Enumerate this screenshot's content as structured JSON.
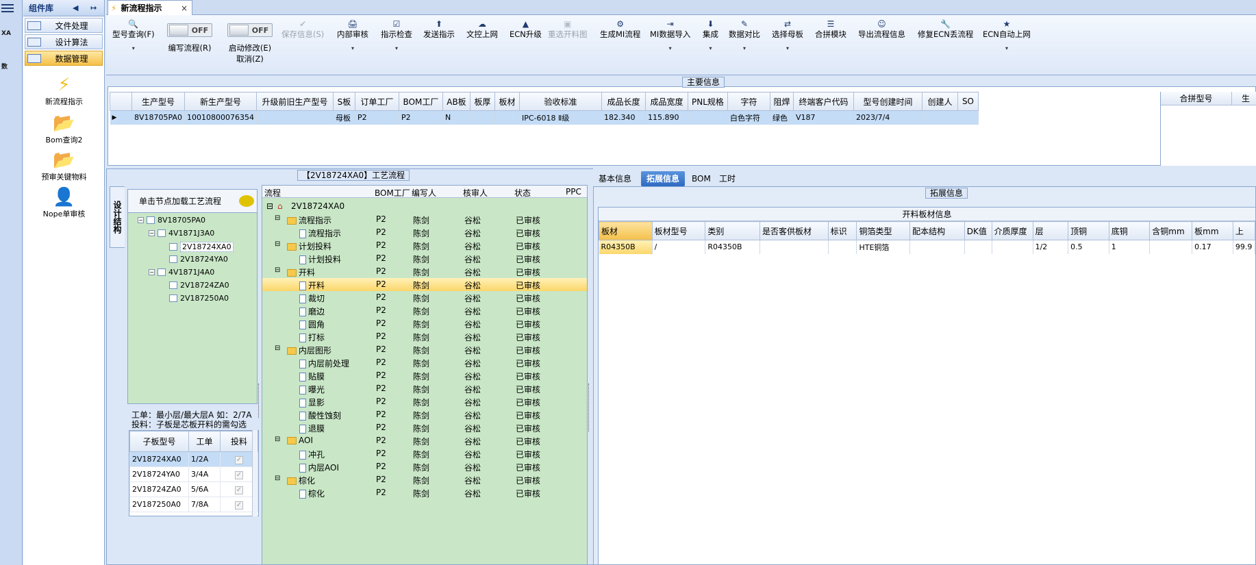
{
  "left_strip": {
    "app_icons": [
      "XA",
      "数"
    ]
  },
  "complib": {
    "title": "组件库",
    "nav": [
      "文件处理",
      "设计算法",
      "数据管理"
    ],
    "tools": [
      "新流程指示",
      "Bom查询2",
      "预审关键物料",
      "Nope单审核"
    ]
  },
  "tab": {
    "title": "新流程指示",
    "close": "×"
  },
  "ribbon": {
    "buttons": [
      {
        "label": "型号查询(F)",
        "icon": "🔍",
        "dd": "▾"
      },
      {
        "label": "保存信息(S)",
        "icon": "✔",
        "dd": ""
      },
      {
        "label": "内部审核",
        "icon": "🖨",
        "dd": "▾"
      },
      {
        "label": "指示检查",
        "icon": "☑",
        "dd": "▾"
      },
      {
        "label": "发送指示",
        "icon": "⬆",
        "dd": ""
      },
      {
        "label": "文控上网",
        "icon": "☁",
        "dd": ""
      },
      {
        "label": "ECN升级",
        "icon": "▲",
        "dd": ""
      },
      {
        "label": "重选开料图",
        "icon": "▣",
        "dd": ""
      },
      {
        "label": "生成MI流程",
        "icon": "⚙",
        "dd": ""
      },
      {
        "label": "MI数据导入",
        "icon": "⇥",
        "dd": "▾"
      },
      {
        "label": "集成",
        "icon": "⬇",
        "dd": "▾"
      },
      {
        "label": "数据对比",
        "icon": "✎",
        "dd": "▾"
      },
      {
        "label": "选择母板",
        "icon": "⇄",
        "dd": "▾"
      },
      {
        "label": "合拼模块",
        "icon": "☰",
        "dd": ""
      },
      {
        "label": "导出流程信息",
        "icon": "☺",
        "dd": ""
      },
      {
        "label": "修复ECN丢流程",
        "icon": "🔧",
        "dd": ""
      },
      {
        "label": "ECN自动上网",
        "icon": "★",
        "dd": "▾"
      }
    ],
    "toggle1": {
      "value": "OFF",
      "label": "编写流程(R)"
    },
    "toggle2": {
      "value": "OFF",
      "label1": "启动修改(E)",
      "label2": "取消(Z)"
    }
  },
  "main_info": {
    "title": "主要信息",
    "columns": [
      "生产型号",
      "新生产型号",
      "升级前旧生产型号",
      "S板",
      "订单工厂",
      "BOM工厂",
      "AB板",
      "板厚",
      "板材",
      "验收标准",
      "成品长度",
      "成品宽度",
      "PNL规格",
      "字符",
      "阻焊",
      "终端客户代码",
      "型号创建时间",
      "创建人",
      "SO"
    ],
    "row": [
      "8V18705PA0",
      "10010800076354",
      "",
      "母板",
      "P2",
      "P2",
      "N",
      "",
      "",
      "IPC-6018 Ⅱ级",
      "182.340",
      "115.890",
      "",
      "白色字符",
      "绿色",
      "V187",
      "2023/7/4",
      "",
      ""
    ],
    "side_columns": [
      "合拼型号",
      "生"
    ]
  },
  "process": {
    "title": "【2V18724XA0】工艺流程",
    "vtab": "设计结构",
    "tree_header": "单击节点加载工艺流程",
    "tree": [
      "8V18705PA0",
      "4V1871J3A0",
      "2V18724XA0",
      "2V18724YA0",
      "4V1871J4A0",
      "2V18724ZA0",
      "2V187250A0"
    ],
    "note1": "工单：最小层/最大层A 如：2/7A",
    "note2": "投料：子板是芯板开料的需勾选",
    "sub_columns": [
      "子板型号",
      "工单",
      "投料"
    ],
    "sub_rows": [
      [
        "2V18724XA0",
        "1/2A",
        "✓"
      ],
      [
        "2V18724YA0",
        "3/4A",
        "✓"
      ],
      [
        "2V18724ZA0",
        "5/6A",
        "✓"
      ],
      [
        "2V187250A0",
        "7/8A",
        "✓"
      ]
    ],
    "flow_columns": [
      "流程",
      "BOM工厂",
      "编写人",
      "核审人",
      "状态",
      "PPC"
    ],
    "root": "2V18724XA0",
    "flow_rows": [
      {
        "level": 1,
        "name": "流程指示",
        "bom": "P2",
        "writer": "陈剑",
        "reviewer": "谷松",
        "status": "已审核"
      },
      {
        "level": 2,
        "name": "流程指示",
        "bom": "P2",
        "writer": "陈剑",
        "reviewer": "谷松",
        "status": "已审核"
      },
      {
        "level": 1,
        "name": "计划投料",
        "bom": "P2",
        "writer": "陈剑",
        "reviewer": "谷松",
        "status": "已审核"
      },
      {
        "level": 2,
        "name": "计划投料",
        "bom": "P2",
        "writer": "陈剑",
        "reviewer": "谷松",
        "status": "已审核"
      },
      {
        "level": 1,
        "name": "开料",
        "bom": "P2",
        "writer": "陈剑",
        "reviewer": "谷松",
        "status": "已审核"
      },
      {
        "level": 2,
        "name": "开料",
        "bom": "P2",
        "writer": "陈剑",
        "reviewer": "谷松",
        "status": "已审核"
      },
      {
        "level": 2,
        "name": "裁切",
        "bom": "P2",
        "writer": "陈剑",
        "reviewer": "谷松",
        "status": "已审核"
      },
      {
        "level": 2,
        "name": "磨边",
        "bom": "P2",
        "writer": "陈剑",
        "reviewer": "谷松",
        "status": "已审核"
      },
      {
        "level": 2,
        "name": "圆角",
        "bom": "P2",
        "writer": "陈剑",
        "reviewer": "谷松",
        "status": "已审核"
      },
      {
        "level": 2,
        "name": "打标",
        "bom": "P2",
        "writer": "陈剑",
        "reviewer": "谷松",
        "status": "已审核"
      },
      {
        "level": 1,
        "name": "内层图形",
        "bom": "P2",
        "writer": "陈剑",
        "reviewer": "谷松",
        "status": "已审核"
      },
      {
        "level": 2,
        "name": "内层前处理",
        "bom": "P2",
        "writer": "陈剑",
        "reviewer": "谷松",
        "status": "已审核"
      },
      {
        "level": 2,
        "name": "贴膜",
        "bom": "P2",
        "writer": "陈剑",
        "reviewer": "谷松",
        "status": "已审核"
      },
      {
        "level": 2,
        "name": "曝光",
        "bom": "P2",
        "writer": "陈剑",
        "reviewer": "谷松",
        "status": "已审核"
      },
      {
        "level": 2,
        "name": "显影",
        "bom": "P2",
        "writer": "陈剑",
        "reviewer": "谷松",
        "status": "已审核"
      },
      {
        "level": 2,
        "name": "酸性蚀刻",
        "bom": "P2",
        "writer": "陈剑",
        "reviewer": "谷松",
        "status": "已审核"
      },
      {
        "level": 2,
        "name": "退膜",
        "bom": "P2",
        "writer": "陈剑",
        "reviewer": "谷松",
        "status": "已审核"
      },
      {
        "level": 1,
        "name": "AOI",
        "bom": "P2",
        "writer": "陈剑",
        "reviewer": "谷松",
        "status": "已审核"
      },
      {
        "level": 2,
        "name": "冲孔",
        "bom": "P2",
        "writer": "陈剑",
        "reviewer": "谷松",
        "status": "已审核"
      },
      {
        "level": 2,
        "name": "内层AOI",
        "bom": "P2",
        "writer": "陈剑",
        "reviewer": "谷松",
        "status": "已审核"
      },
      {
        "level": 1,
        "name": "棕化",
        "bom": "P2",
        "writer": "陈剑",
        "reviewer": "谷松",
        "status": "已审核"
      },
      {
        "level": 2,
        "name": "棕化",
        "bom": "P2",
        "writer": "陈剑",
        "reviewer": "谷松",
        "status": "已审核"
      }
    ]
  },
  "right": {
    "tabs": [
      "基本信息",
      "拓展信息",
      "BOM",
      "工时"
    ],
    "group_title": "拓展信息",
    "caption": "开料板材信息",
    "columns": [
      "板材",
      "板材型号",
      "类别",
      "是否客供板材",
      "标识",
      "铜箔类型",
      "配本结构",
      "DK值",
      "介质厚度",
      "层",
      "顶铜",
      "底铜",
      "含铜mm",
      "板mm",
      "上"
    ],
    "row": [
      "R04350B",
      "/",
      "R04350B",
      "",
      "",
      "HTE铜箔",
      "",
      "",
      "",
      "1/2",
      "0.5",
      "1",
      "",
      "0.17",
      "99.9"
    ]
  },
  "colors": {
    "accent": "#f6c047",
    "selection": "#c4dcf6",
    "tree_bg": "#c9e7c7",
    "tab_active": "#2e6bc2"
  }
}
